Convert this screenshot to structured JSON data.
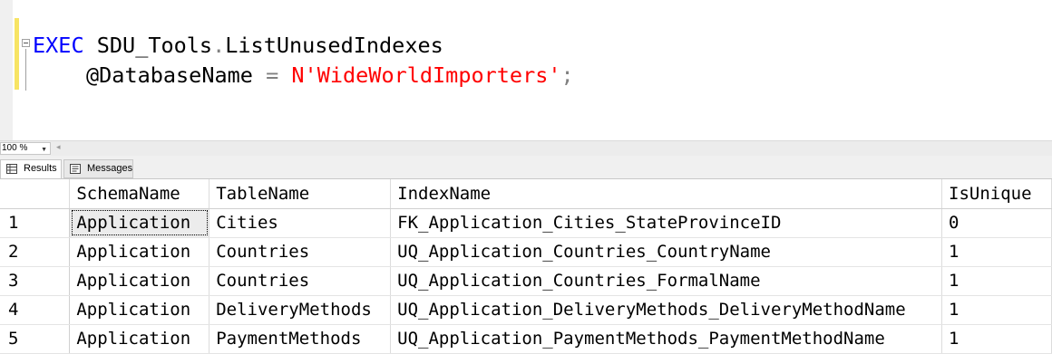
{
  "editor": {
    "line1": {
      "kw": "EXEC",
      "obj": "SDU_Tools",
      "dot": ".",
      "proc": "ListUnusedIndexes"
    },
    "line2": {
      "param": "@DatabaseName",
      "eq": "=",
      "value": "N'WideWorldImporters'",
      "semi": ";"
    }
  },
  "zoom": {
    "value": "100 %"
  },
  "tabs": [
    {
      "label": "Results",
      "icon": "grid-icon"
    },
    {
      "label": "Messages",
      "icon": "messages-icon"
    }
  ],
  "grid": {
    "columns": [
      "",
      "SchemaName",
      "TableName",
      "IndexName",
      "IsUnique"
    ],
    "rows": [
      [
        "1",
        "Application",
        "Cities",
        "FK_Application_Cities_StateProvinceID",
        "0"
      ],
      [
        "2",
        "Application",
        "Countries",
        "UQ_Application_Countries_CountryName",
        "1"
      ],
      [
        "3",
        "Application",
        "Countries",
        "UQ_Application_Countries_FormalName",
        "1"
      ],
      [
        "4",
        "Application",
        "DeliveryMethods",
        "UQ_Application_DeliveryMethods_DeliveryMethodName",
        "1"
      ],
      [
        "5",
        "Application",
        "PaymentMethods",
        "UQ_Application_PaymentMethods_PaymentMethodName",
        "1"
      ]
    ]
  },
  "colors": {
    "keyword": "#0000ff",
    "string": "#ff0000",
    "operator": "#808080",
    "change_bar": "#f7e463"
  }
}
